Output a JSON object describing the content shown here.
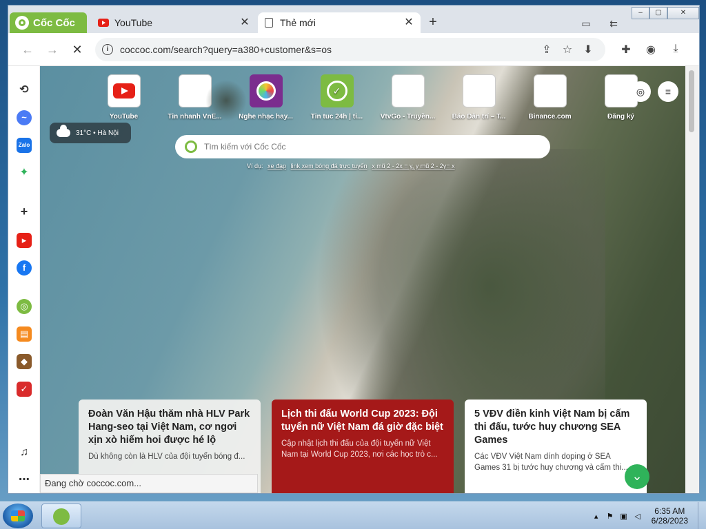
{
  "tabs": {
    "brand": "Cốc Cốc",
    "youtube": "YouTube",
    "newtab": "Thẻ mới",
    "close_glyph": "✕",
    "new_tab_glyph": "+"
  },
  "address": {
    "url": "coccoc.com/search?query=a380+customer&s=os"
  },
  "shortcuts": [
    {
      "label": "YouTube"
    },
    {
      "label": "Tin nhanh VnE..."
    },
    {
      "label": "Nghe nhạc hay..."
    },
    {
      "label": "Tin tuc 24h | ti..."
    },
    {
      "label": "VtvGo - Truyền..."
    },
    {
      "label": "Báo Dân trí – T..."
    },
    {
      "label": "Binance.com"
    },
    {
      "label": "Đăng ký"
    }
  ],
  "weather": {
    "text": "31°C • Hà Nội"
  },
  "search": {
    "placeholder": "Tìm kiếm với Cốc Cốc",
    "suggest_label": "Ví dụ:",
    "suggestions": [
      "xe đạp",
      "link xem bóng đá trực tuyến",
      "x mũ 2 - 2x = y, y mũ 2 - 2y= x"
    ]
  },
  "cards": [
    {
      "title": "Đoàn Văn Hậu thăm nhà HLV Park Hang-seo tại Việt Nam, cơ ngơi xịn xò hiếm hoi được hé lộ",
      "desc": "Dù không còn là HLV của đội tuyển bóng đ..."
    },
    {
      "title": "Lịch thi đấu World Cup 2023: Đội tuyển nữ Việt Nam đá giờ đặc biệt",
      "desc": "Cập nhật lịch thi đấu của đội tuyển nữ Việt Nam tại World Cup 2023, nơi các học trò c..."
    },
    {
      "title": "5 VĐV điền kinh Việt Nam bị cấm thi đấu, tước huy chương SEA Games",
      "desc": "Các VĐV Việt Nam dính doping ở SEA Games 31 bị tước huy chương và cấm thi..."
    }
  ],
  "status": {
    "text": "Đang chờ coccoc.com..."
  },
  "taskbar": {
    "time": "6:35 AM",
    "date": "6/28/2023"
  },
  "colors": {
    "brand_green": "#7dbb42",
    "news_red": "#a51919",
    "scroll_green": "#2fb35a"
  }
}
